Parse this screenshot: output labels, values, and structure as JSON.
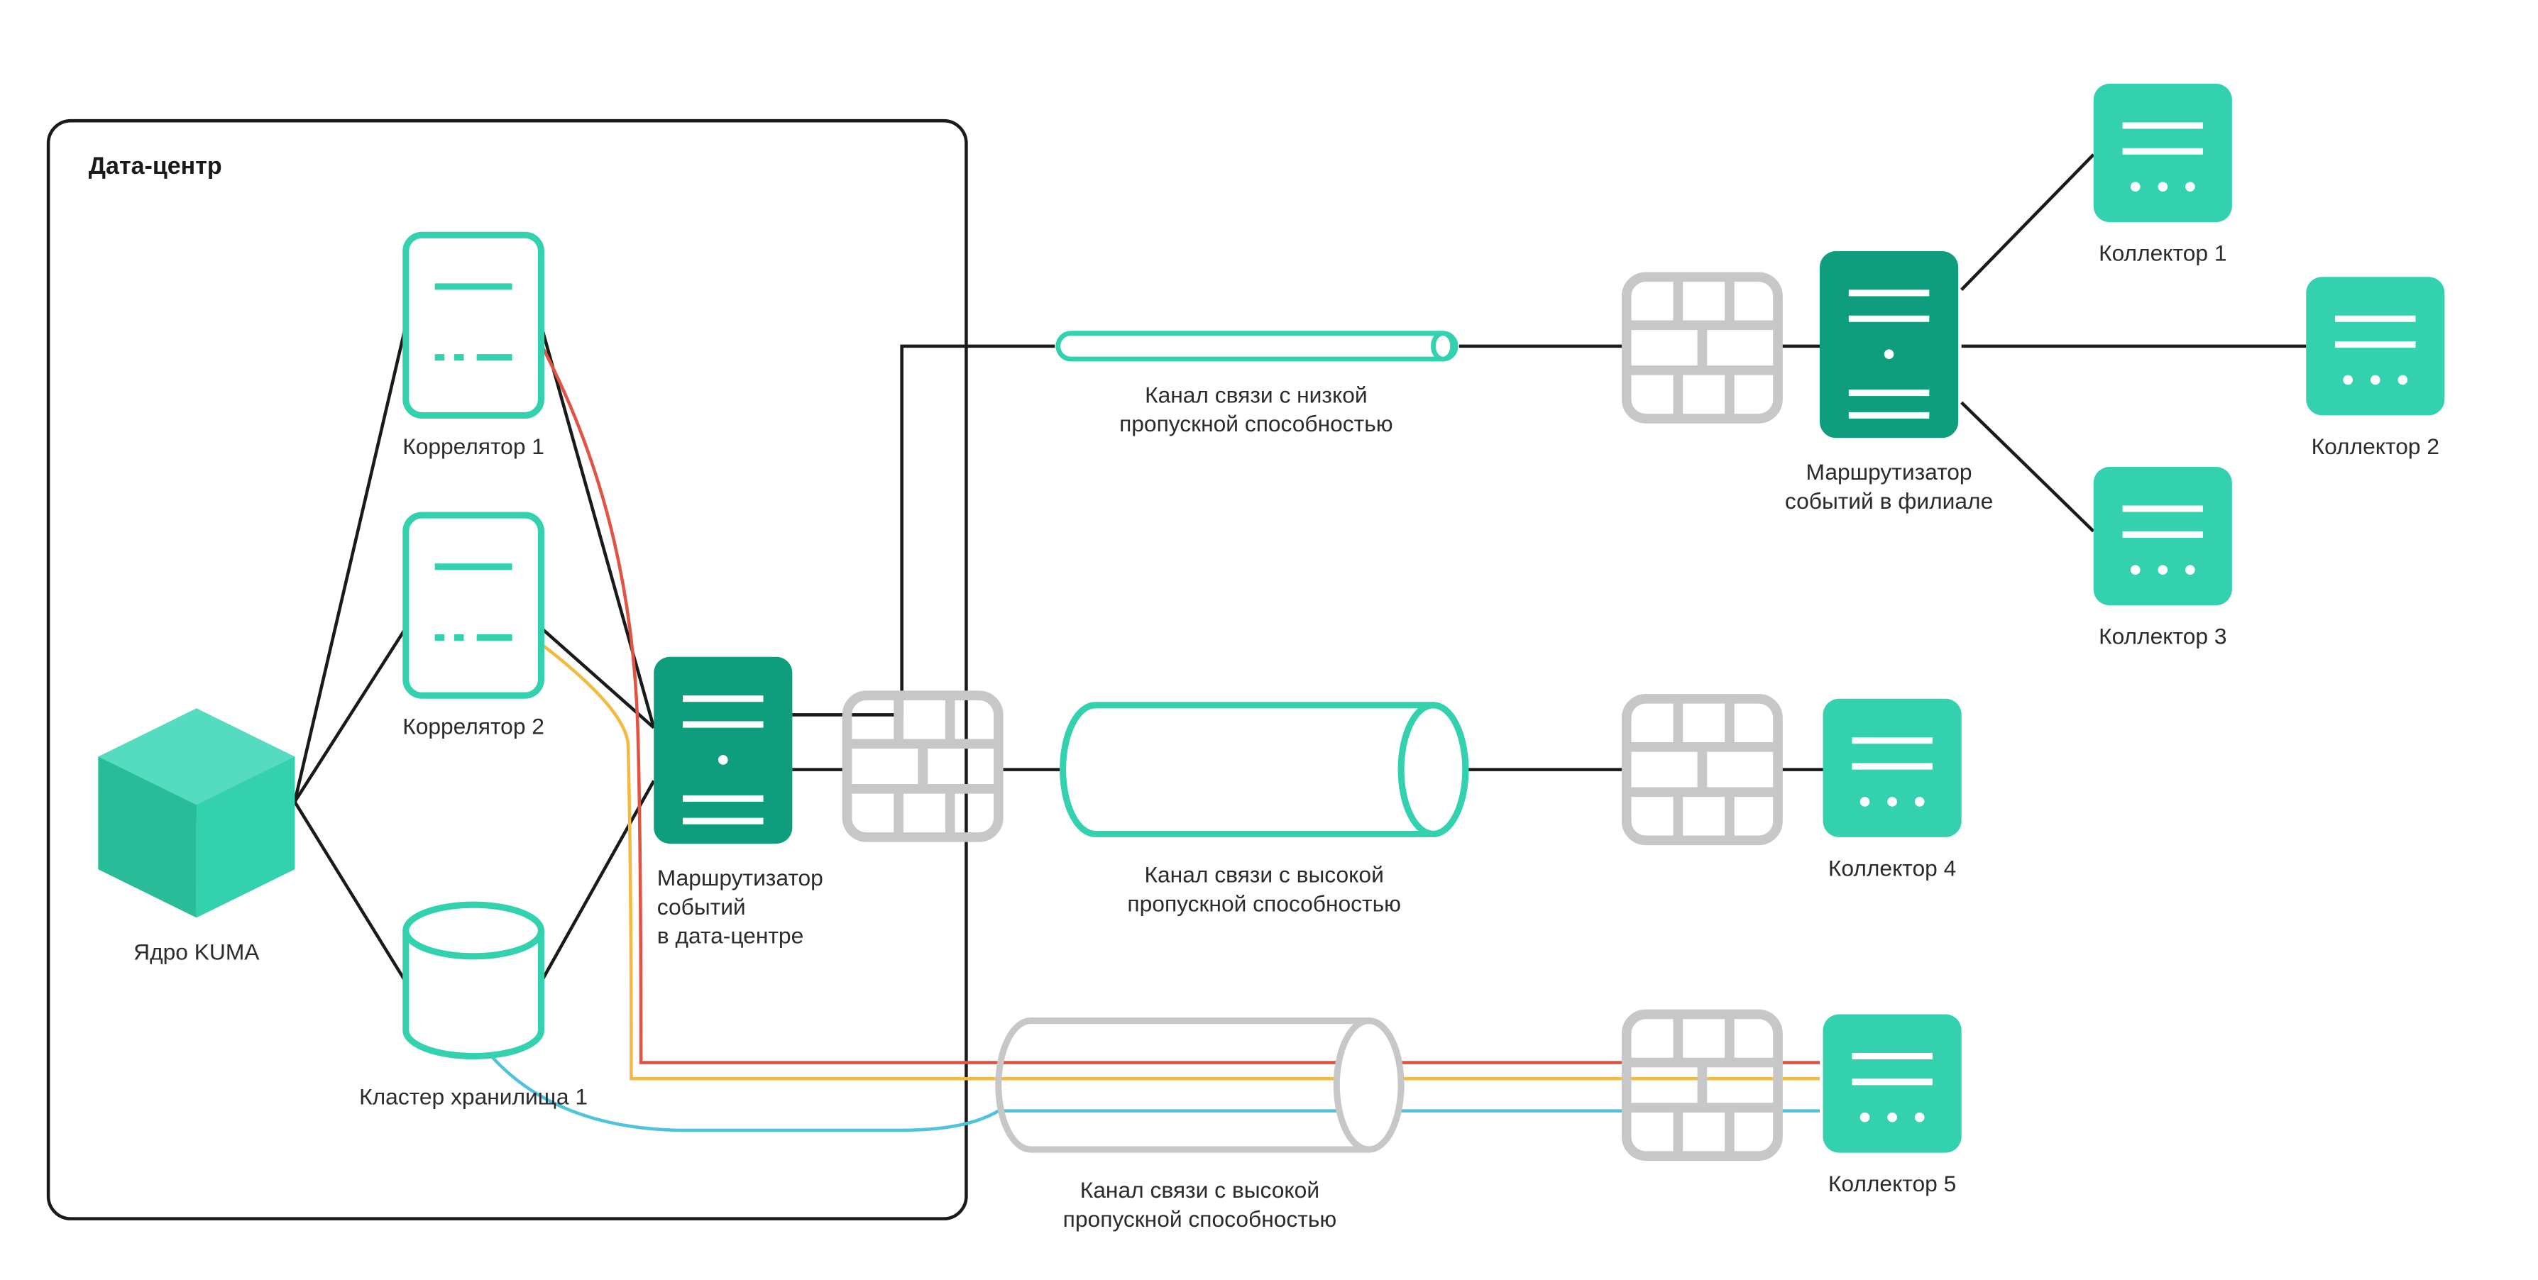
{
  "colors": {
    "teal": "#33D1AD",
    "tealDark": "#0E9E7E",
    "tealDarker": "#0A8F72",
    "gray": "#C7C7C7",
    "grayLine": "#BDBDBD",
    "black": "#1a1a1a",
    "red": "#E15343",
    "yellow": "#F4B942",
    "cyan": "#4EC3D9"
  },
  "box": {
    "title": "Дата-центр"
  },
  "core": {
    "label": "Ядро KUMA"
  },
  "correlator1": {
    "label": "Коррелятор 1"
  },
  "correlator2": {
    "label": "Коррелятор 2"
  },
  "storage": {
    "label": "Кластер хранилища 1"
  },
  "routerDC": {
    "line1": "Маршрутизатор",
    "line2": "событий",
    "line3": "в дата-центре"
  },
  "routerBranch": {
    "line1": "Маршрутизатор",
    "line2": "событий в филиале"
  },
  "channelLow": {
    "line1": "Канал связи с низкой",
    "line2": "пропускной способностью"
  },
  "channelHigh1": {
    "line1": "Канал связи с высокой",
    "line2": "пропускной способностью"
  },
  "channelHigh2": {
    "line1": "Канал связи с высокой",
    "line2": "пропускной способностью"
  },
  "collector1": {
    "label": "Коллектор 1"
  },
  "collector2": {
    "label": "Коллектор 2"
  },
  "collector3": {
    "label": "Коллектор 3"
  },
  "collector4": {
    "label": "Коллектор 4"
  },
  "collector5": {
    "label": "Коллектор 5"
  }
}
